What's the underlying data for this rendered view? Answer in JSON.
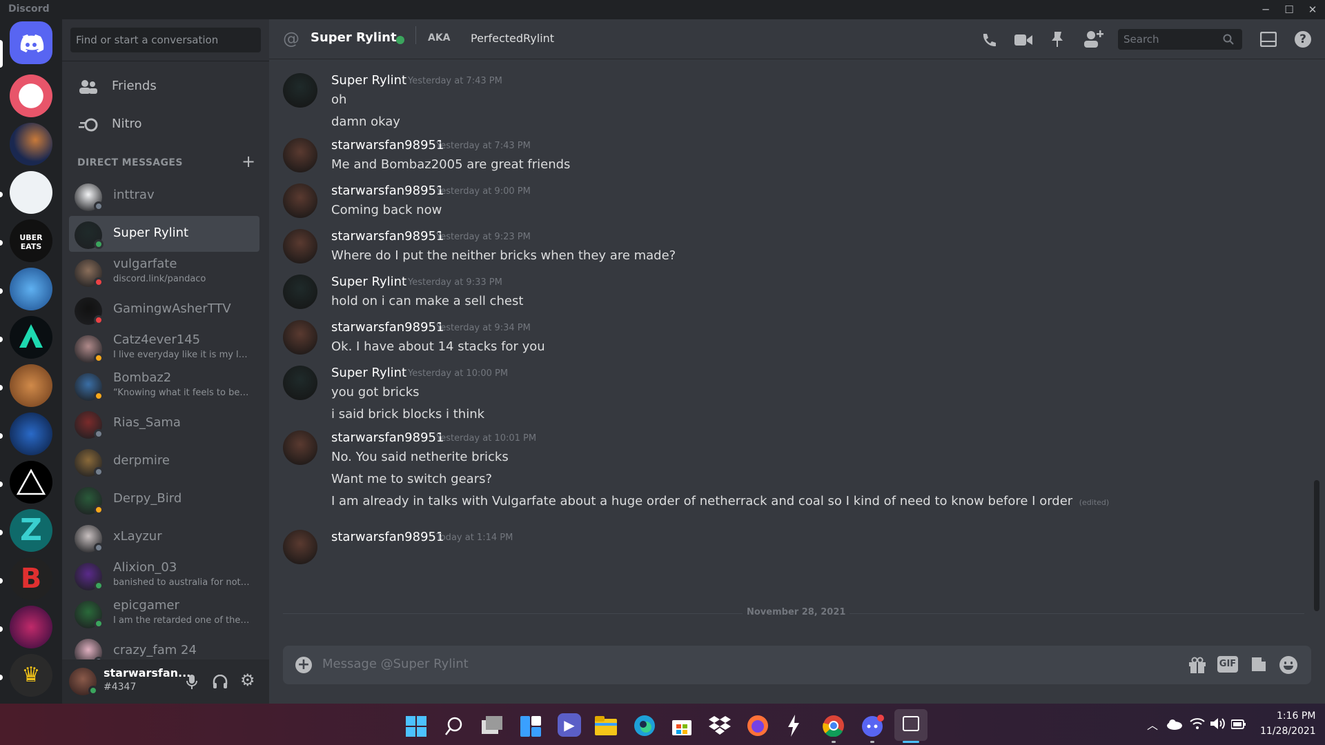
{
  "app": {
    "title": "Discord"
  },
  "search": {
    "placeholder": "Find or start a conversation"
  },
  "nav": {
    "friends": "Friends",
    "nitro": "Nitro"
  },
  "dm_header": "DIRECT MESSAGES",
  "dms": [
    {
      "name": "inttrav",
      "sub": "",
      "status": "offline",
      "color": "#f2f3f5",
      "selected": false
    },
    {
      "name": "Super Rylint",
      "sub": "",
      "status": "online",
      "color": "#1f2a2a",
      "selected": true
    },
    {
      "name": "vulgarfate",
      "sub": "discord.link/pandaco",
      "status": "dnd",
      "color": "#8a6e5a",
      "selected": false
    },
    {
      "name": "GamingwAsherTTV",
      "sub": "",
      "status": "dnd",
      "color": "#111111",
      "selected": false
    },
    {
      "name": "Catz4ever145",
      "sub": "I live everyday like it is my la...",
      "status": "idle",
      "color": "#b08a8a",
      "selected": false
    },
    {
      "name": "Bombaz2",
      "sub": "“Knowing what it feels to be i...",
      "status": "idle",
      "color": "#3a6ea5",
      "selected": false
    },
    {
      "name": "Rias_Sama",
      "sub": "",
      "status": "offline",
      "color": "#7a2b2b",
      "selected": false
    },
    {
      "name": "derpmire",
      "sub": "",
      "status": "offline",
      "color": "#8a6a3a",
      "selected": false
    },
    {
      "name": "Derpy_Bird",
      "sub": "",
      "status": "idle",
      "color": "#2a5a3a",
      "selected": false
    },
    {
      "name": "xLayzur",
      "sub": "",
      "status": "offline",
      "color": "#c8c0c0",
      "selected": false
    },
    {
      "name": "Alixion_03",
      "sub": "banished to australia for not l...",
      "status": "online",
      "color": "#5a2a8a",
      "selected": false
    },
    {
      "name": "epicgamer",
      "sub": "I am the retarded one of the ...",
      "status": "online",
      "color": "#2a6a3a",
      "selected": false
    },
    {
      "name": "crazy_fam 24",
      "sub": "",
      "status": "offline",
      "color": "#e0b0c0",
      "selected": false
    }
  ],
  "user": {
    "name": "starwarsfan...",
    "tag": "#4347"
  },
  "chat_header": {
    "name": "Super Rylint",
    "aka_label": "AKA",
    "aka": "PerfectedRylint",
    "search_placeholder": "Search"
  },
  "messages": [
    {
      "author": "Super Rylint",
      "time": "Yesterday at 7:43 PM",
      "lines": [
        "oh",
        "damn okay"
      ],
      "edited_last": false
    },
    {
      "author": "starwarsfan98951",
      "time": "Yesterday at 7:43 PM",
      "lines": [
        "Me and Bombaz2005 are great friends"
      ],
      "edited_last": false
    },
    {
      "author": "starwarsfan98951",
      "time": "Yesterday at 9:00 PM",
      "lines": [
        "Coming back now"
      ],
      "edited_last": false
    },
    {
      "author": "starwarsfan98951",
      "time": "Yesterday at 9:23 PM",
      "lines": [
        "Where do I put the neither bricks when they are made?"
      ],
      "edited_last": false
    },
    {
      "author": "Super Rylint",
      "time": "Yesterday at 9:33 PM",
      "lines": [
        "hold on i can make a sell chest"
      ],
      "edited_last": false
    },
    {
      "author": "starwarsfan98951",
      "time": "Yesterday at 9:34 PM",
      "lines": [
        "Ok. I have about 14 stacks for you"
      ],
      "edited_last": false
    },
    {
      "author": "Super Rylint",
      "time": "Yesterday at 10:00 PM",
      "lines": [
        "you got bricks",
        "i said brick blocks i think"
      ],
      "edited_last": false
    },
    {
      "author": "starwarsfan98951",
      "time": "Yesterday at 10:01 PM",
      "lines": [
        "No. You said netherite bricks",
        "Want me to switch gears?",
        "I am already in talks with Vulgarfate about a huge order of netherrack and coal so I kind of need to know before I order"
      ],
      "edited_last": true
    },
    {
      "author": "starwarsfan98951",
      "time": "Today at 1:14 PM",
      "lines": [],
      "edited_last": false
    }
  ],
  "edited_label": "(edited)",
  "date_divider": "November 28, 2021",
  "composer": {
    "placeholder": "Message @Super Rylint",
    "gif_label": "GIF"
  },
  "taskbar": {
    "time": "1:16 PM",
    "date": "11/28/2021"
  },
  "colors": {
    "accent": "#5865f2",
    "online": "#3ba55d",
    "idle": "#faa81a",
    "dnd": "#ed4245",
    "offline": "#747f8d"
  }
}
